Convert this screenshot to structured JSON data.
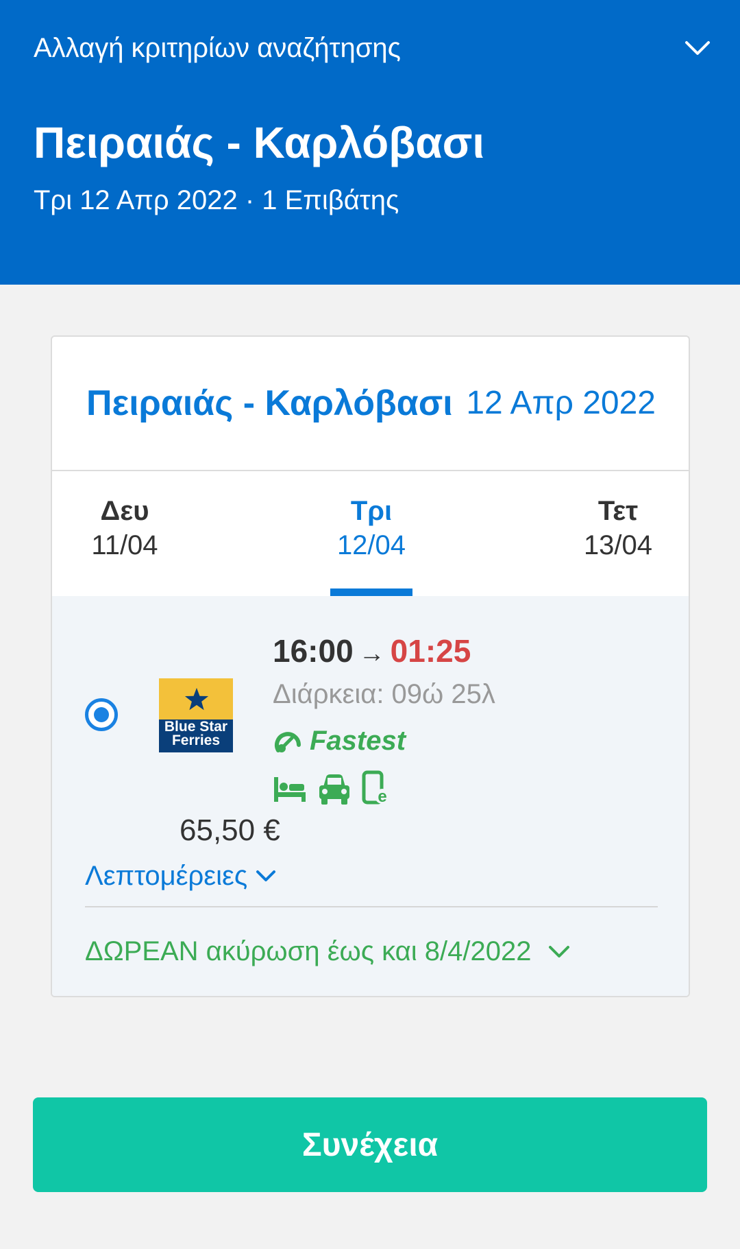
{
  "header": {
    "change_criteria": "Αλλαγή κριτηρίων αναζήτησης",
    "route": "Πειραιάς - Καρλόβασι",
    "subtitle": "Τρι 12 Απρ 2022 · 1 Επιβάτης",
    "background_color": "#016ac8",
    "expand_icon": "chevron-down-icon"
  },
  "card": {
    "route": "Πειραιάς - Καρλόβασι",
    "date": "12 Απρ 2022",
    "days": [
      {
        "name": "Δευ",
        "date": "11/04",
        "active": false
      },
      {
        "name": "Τρι",
        "date": "12/04",
        "active": true
      },
      {
        "name": "Τετ",
        "date": "13/04",
        "active": false
      }
    ],
    "result": {
      "selected": true,
      "operator_logo_text": [
        "Blue Star",
        "Ferries"
      ],
      "departure": "16:00",
      "arrow": "→",
      "arrival": "01:25",
      "duration": "Διάρκεια: 09ώ 25λ",
      "badge": "Fastest",
      "badge_icon": "speedometer-icon",
      "amenity_icons": [
        "bed-icon",
        "car-icon",
        "e-ticket-icon"
      ],
      "price": "65,50 €",
      "details_label": "Λεπτομέρειες",
      "free_cancellation": "ΔΩΡΕΑΝ ακύρωση έως και 8/4/2022"
    }
  },
  "continue_button": {
    "label": "Συνέχεια",
    "color": "#10c6a6"
  }
}
